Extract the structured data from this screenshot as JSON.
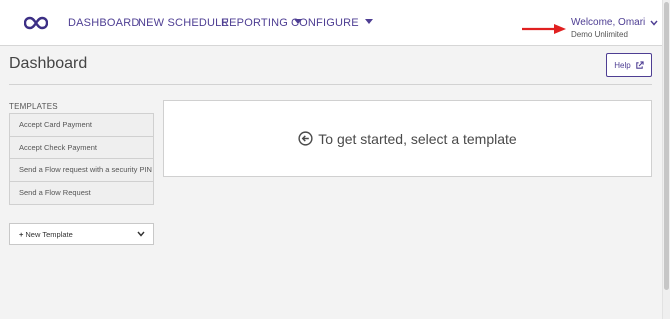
{
  "nav": {
    "items": [
      {
        "label": "DASHBOARD",
        "has_caret": false
      },
      {
        "label": "NEW SCHEDULE",
        "has_caret": false
      },
      {
        "label": "REPORTING",
        "has_caret": true
      },
      {
        "label": "CONFIGURE",
        "has_caret": true
      }
    ],
    "logo_icon": "infinity-logo-icon",
    "accent_color": "#4e3e93"
  },
  "user": {
    "welcome": "Welcome, Omari",
    "org": "Demo Unlimited",
    "pointer_arrow_color": "#e02020"
  },
  "page": {
    "title": "Dashboard",
    "help_label": "Help",
    "help_icon": "external-link-icon"
  },
  "templates": {
    "heading": "TEMPLATES",
    "items": [
      "Accept Card Payment",
      "Accept Check Payment",
      "Send a Flow request with a security PIN",
      "Send a Flow Request"
    ],
    "new_template_label": "New Template",
    "new_template_plus": "+"
  },
  "main": {
    "prompt": "To get started, select a template",
    "prompt_icon": "arrow-left-circle-icon"
  }
}
